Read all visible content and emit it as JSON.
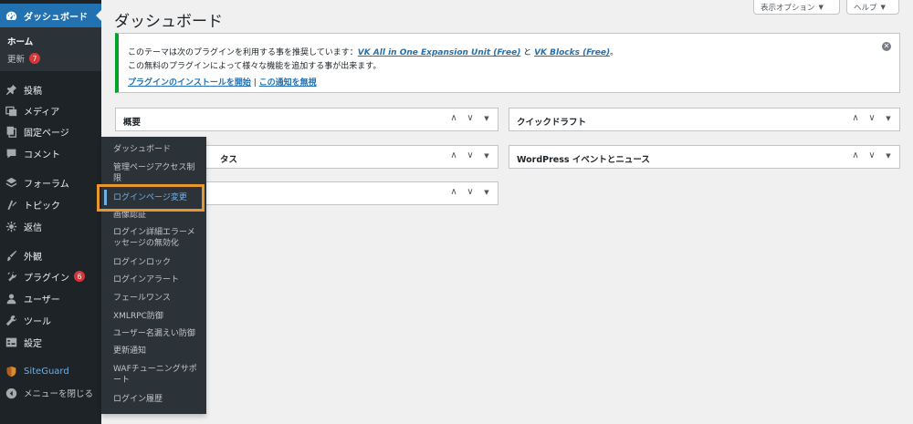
{
  "sidebar": {
    "dashboard_label": "ダッシュボード",
    "sub_home": "ホーム",
    "sub_updates": "更新",
    "updates_badge": "7",
    "items": [
      {
        "label": "投稿",
        "icon": "pin-icon"
      },
      {
        "label": "メディア",
        "icon": "media-icon"
      },
      {
        "label": "固定ページ",
        "icon": "page-icon"
      },
      {
        "label": "コメント",
        "icon": "comment-icon"
      },
      {
        "label": "フォーラム",
        "icon": "forum-icon"
      },
      {
        "label": "トピック",
        "icon": "topic-icon"
      },
      {
        "label": "返信",
        "icon": "reply-icon"
      },
      {
        "label": "外観",
        "icon": "brush-icon"
      },
      {
        "label": "プラグイン",
        "icon": "plugin-icon"
      },
      {
        "label": "ユーザー",
        "icon": "user-icon"
      },
      {
        "label": "ツール",
        "icon": "wrench-icon"
      },
      {
        "label": "設定",
        "icon": "settings-icon"
      }
    ],
    "plugins_badge": "6",
    "siteguard_label": "SiteGuard",
    "collapse_label": "メニューを閉じる"
  },
  "flyout": {
    "items": [
      "ダッシュボード",
      "管理ページアクセス制限",
      "ログインページ変更",
      "画像認証",
      "ログイン詳細エラーメッセージの無効化",
      "ログインロック",
      "ログインアラート",
      "フェールワンス",
      "XMLRPC防御",
      "ユーザー名漏えい防御",
      "更新通知",
      "WAFチューニングサポート",
      "ログイン履歴"
    ]
  },
  "header": {
    "title": "ダッシュボード",
    "screen_options": "表示オプション",
    "help": "ヘルプ"
  },
  "notice": {
    "line1_prefix": "このテーマは次のプラグインを利用する事を推奨しています：",
    "plugin1": "VK All in One Expansion Unit (Free)",
    "and": "と",
    "plugin2": "VK Blocks (Free)",
    "period": "。",
    "line2": "この無料のプラグインによって様々な機能を追加する事が出来ます。",
    "install_link": "プラグインのインストールを開始",
    "separator": "|",
    "dismiss_link": "この通知を無視"
  },
  "widgets": {
    "overview": "概要",
    "quick_draft": "クイックドラフト",
    "activity_partial": "タス",
    "events": "WordPress イベントとニュース"
  },
  "colors": {
    "sidebar_bg": "#1d2327",
    "active_bg": "#2271b1",
    "notice_border": "#00a32a",
    "highlight_box": "#e8972c",
    "link": "#2271b1",
    "badge": "#d63638"
  }
}
